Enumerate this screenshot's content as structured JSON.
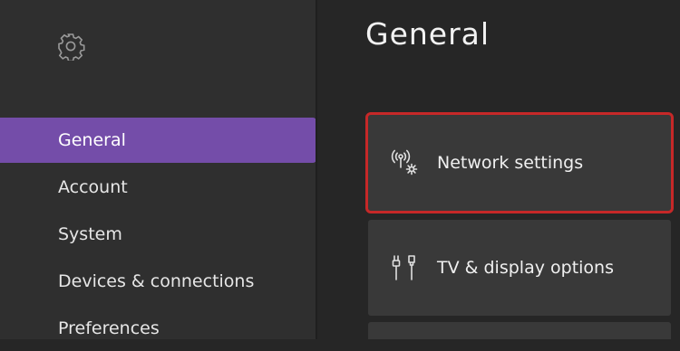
{
  "sidebar": {
    "items": [
      {
        "label": "General",
        "selected": true
      },
      {
        "label": "Account"
      },
      {
        "label": "System"
      },
      {
        "label": "Devices & connections"
      },
      {
        "label": "Preferences"
      }
    ]
  },
  "main": {
    "title": "General",
    "tiles": [
      {
        "label": "Network settings",
        "icon": "network-settings-icon",
        "highlighted": true
      },
      {
        "label": "TV & display options",
        "icon": "tv-display-icon"
      },
      {
        "label": "",
        "icon": ""
      }
    ]
  },
  "colors": {
    "accent": "#744da9",
    "highlight_border": "#c62828",
    "tile_bg": "#393939",
    "sidebar_bg": "#2f2f2f"
  }
}
